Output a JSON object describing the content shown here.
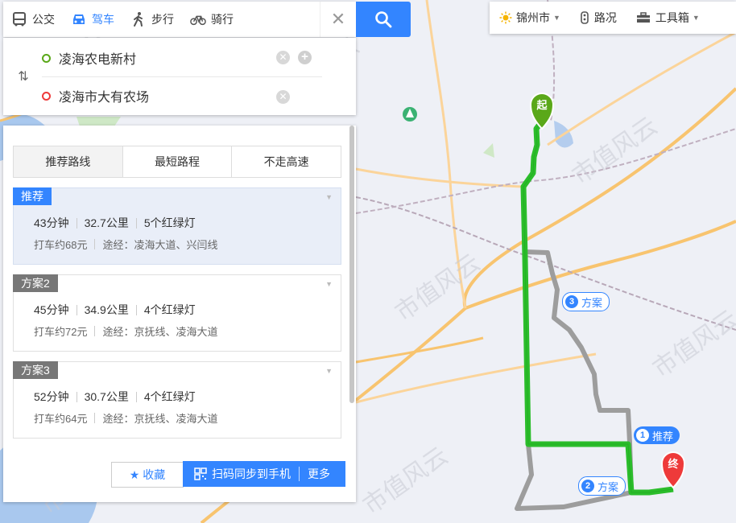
{
  "modes": [
    {
      "label": "公交",
      "icon": "bus-icon",
      "active": false
    },
    {
      "label": "驾车",
      "icon": "car-icon",
      "active": true
    },
    {
      "label": "步行",
      "icon": "walk-icon",
      "active": false
    },
    {
      "label": "骑行",
      "icon": "bike-icon",
      "active": false
    }
  ],
  "close_symbol": "✕",
  "route": {
    "start": "凌海农电新村",
    "end": "凌海市大有农场",
    "swap_symbol": "⇅"
  },
  "route_tabs": [
    "推荐路线",
    "最短路程",
    "不走高速"
  ],
  "plans": [
    {
      "tag": "推荐",
      "tag_color": "#3385ff",
      "time": "43分钟",
      "distance": "32.7公里",
      "lights": "5个红绿灯",
      "taxi": "打车约68元",
      "via": "途经：凌海大道、兴闫线"
    },
    {
      "tag": "方案2",
      "tag_color": "#777777",
      "time": "45分钟",
      "distance": "34.9公里",
      "lights": "4个红绿灯",
      "taxi": "打车约72元",
      "via": "途经：京抚线、凌海大道"
    },
    {
      "tag": "方案3",
      "tag_color": "#777777",
      "time": "52分钟",
      "distance": "30.7公里",
      "lights": "4个红绿灯",
      "taxi": "打车约64元",
      "via": "途经：京抚线、凌海大道"
    }
  ],
  "footer": {
    "favorite": "收藏",
    "sync": "扫码同步到手机",
    "more": "更多"
  },
  "toolbar": {
    "city": "锦州市",
    "traffic": "路况",
    "tools": "工具箱"
  },
  "map": {
    "start_marker": "起",
    "end_marker": "终",
    "labels": [
      {
        "num": "1",
        "text": "推荐"
      },
      {
        "num": "2",
        "text": "方案"
      },
      {
        "num": "3",
        "text": "方案"
      }
    ],
    "watermark": "市值风云"
  },
  "colors": {
    "accent": "#3385ff",
    "route_main": "#2bbd2b",
    "route_alt": "#a9a9a9",
    "start": "#5aa819",
    "end": "#ee3a3a"
  }
}
